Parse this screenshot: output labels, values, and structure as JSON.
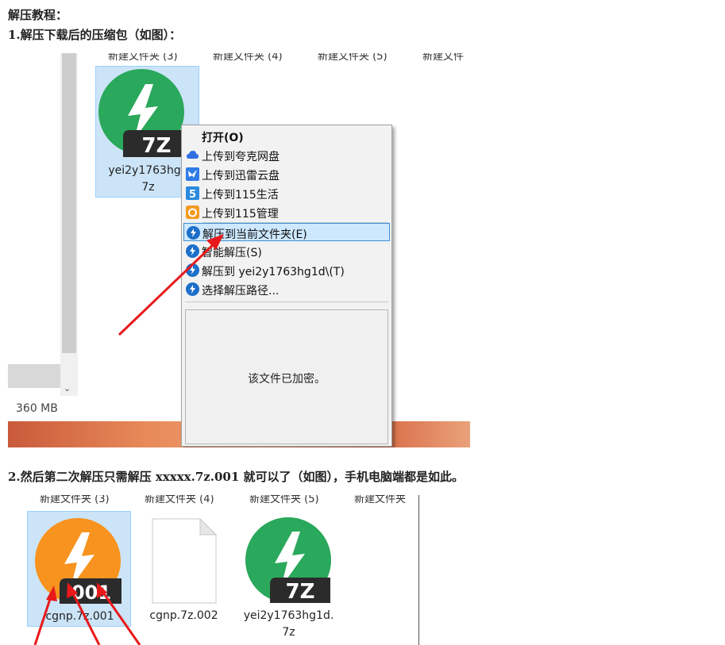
{
  "headings": {
    "title": "解压教程：",
    "step1": "1.解压下载后的压缩包（如图）：",
    "step2": "2.然后第二次解压只需解压 xxxxx.7z.001 就可以了（如图），手机电脑端都是如此。"
  },
  "shot1": {
    "folders": [
      "新建文件夹 (3)",
      "新建文件夹 (4)",
      "新建文件夹 (5)",
      "新建文件"
    ],
    "file": {
      "badge": "7Z",
      "name_line1": "yei2y1763hg1",
      "name_line2": "7z"
    },
    "size_text": "360 MB",
    "context_menu": {
      "items": [
        {
          "label": "打开(O)",
          "icon": "none"
        },
        {
          "label": "上传到夸克网盘",
          "icon": "cloud-icon"
        },
        {
          "label": "上传到迅雷云盘",
          "icon": "thunder-bird-icon"
        },
        {
          "label": "上传到115生活",
          "icon": "115-life-icon"
        },
        {
          "label": "上传到115管理",
          "icon": "115-manage-icon"
        },
        {
          "label": "解压到当前文件夹(E)",
          "icon": "bandizip-icon"
        },
        {
          "label": "智能解压(S)",
          "icon": "bandizip-icon"
        },
        {
          "label": "解压到 yei2y1763hg1d\\(T)",
          "icon": "bandizip-icon"
        },
        {
          "label": "选择解压路径...",
          "icon": "bandizip-icon"
        }
      ],
      "preview_text": "该文件已加密。"
    }
  },
  "shot2": {
    "folders": [
      "新建文件夹 (3)",
      "新建文件夹 (4)",
      "新建文件夹 (5)",
      "新建文件夹"
    ],
    "files": [
      {
        "name": "cgnp.7z.001",
        "badge": "001"
      },
      {
        "name": "cgnp.7z.002"
      },
      {
        "name_line1": "yei2y1763hg1d.",
        "name_line2": "7z",
        "badge": "7Z"
      }
    ]
  },
  "colors": {
    "bandizip_green": "#2aa85b",
    "bandizip_orange": "#f7931e",
    "badge_dark": "#2b2b2b",
    "arrow_red": "#e8191b",
    "selection": "#cce4f7",
    "menu_highlight": "#cde8ff"
  }
}
